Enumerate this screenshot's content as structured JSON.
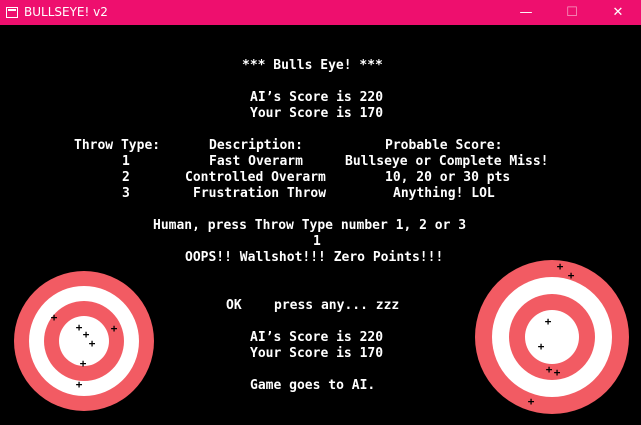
{
  "window": {
    "title": "BULLSEYE! v2",
    "min_glyph": "—",
    "max_glyph": "☐",
    "close_glyph": "✕"
  },
  "game": {
    "heading": "*** Bulls Eye! ***",
    "ai_score_1": "AI’s Score is 220",
    "your_score_1": "Your Score is 170",
    "table": {
      "headers": [
        "Throw Type:",
        "Description:",
        "Probable Score:"
      ],
      "rows": [
        {
          "type": "1",
          "description": "Fast Overarm",
          "score": "Bullseye or Complete Miss!"
        },
        {
          "type": "2",
          "description": "Controlled Overarm",
          "score": "10, 20 or 30 pts"
        },
        {
          "type": "3",
          "description": "Frustration Throw",
          "score": "Anything! LOL"
        }
      ]
    },
    "prompt": "Human, press Throw Type number 1, 2 or 3",
    "input_value": "1",
    "result": "OOPS!! Wallshot!!! Zero Points!!!",
    "continue_ok": "OK",
    "continue_prompt": "press any... zzz",
    "ai_score_2": "AI’s Score is 220",
    "your_score_2": "Your Score is 170",
    "outcome": "Game goes to AI."
  },
  "colors": {
    "titlebar": "#ee0f6e",
    "target_red": "#f25b63",
    "target_white": "#ffffff",
    "background": "#000000"
  }
}
